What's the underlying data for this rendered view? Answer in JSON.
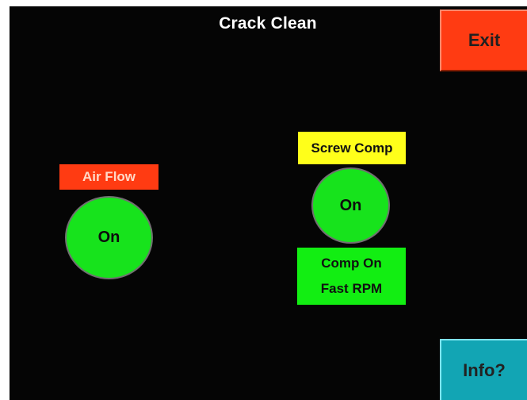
{
  "screen": {
    "title": "Crack Clean"
  },
  "buttons": {
    "exit_label": "Exit",
    "info_label": "Info?"
  },
  "air_flow": {
    "label": "Air Flow",
    "state": "On"
  },
  "screw_comp": {
    "label": "Screw Comp",
    "state": "On",
    "status_line1": "Comp On",
    "status_line2": "Fast RPM"
  },
  "colors": {
    "background": "#050505",
    "exit_button": "#ff3b12",
    "info_button": "#12a5b4",
    "air_flow_tag": "#ff3b12",
    "screw_comp_tag": "#ffff1a",
    "indicator_on": "#17e31c",
    "status_box": "#12ee12"
  }
}
